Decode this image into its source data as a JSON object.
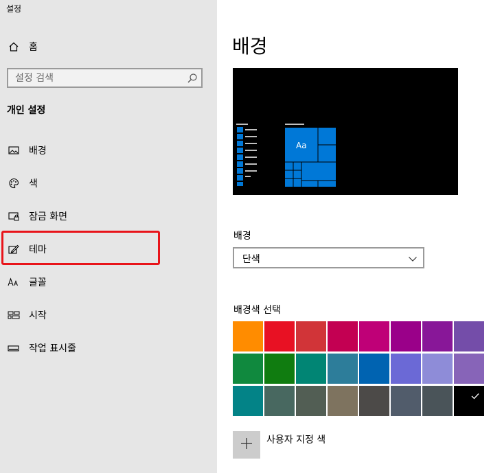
{
  "app": {
    "title": "설정"
  },
  "sidebar": {
    "home_label": "홈",
    "search_placeholder": "설정 검색",
    "section_title": "개인 설정",
    "items": [
      {
        "label": "배경",
        "icon": "picture-icon"
      },
      {
        "label": "색",
        "icon": "palette-icon"
      },
      {
        "label": "잠금 화면",
        "icon": "lock-screen-icon"
      },
      {
        "label": "테마",
        "icon": "theme-brush-icon"
      },
      {
        "label": "글꼴",
        "icon": "font-icon"
      },
      {
        "label": "시작",
        "icon": "start-grid-icon"
      },
      {
        "label": "작업 표시줄",
        "icon": "taskbar-icon"
      }
    ]
  },
  "main": {
    "page_title": "배경",
    "preview_sample_text": "Aa",
    "background_label": "배경",
    "background_value": "단색",
    "color_section_label": "배경색 선택",
    "custom_color_label": "사용자 지정 색",
    "swatches": [
      "#ff8c00",
      "#e81123",
      "#d13438",
      "#c30052",
      "#bf0077",
      "#9a0089",
      "#881798",
      "#744da9",
      "#10893e",
      "#107c10",
      "#018574",
      "#2d7d9a",
      "#0063b1",
      "#6b69d6",
      "#8e8cd8",
      "#8764b8",
      "#038387",
      "#486860",
      "#525e54",
      "#7e735f",
      "#4c4a48",
      "#515c6b",
      "#4a5459",
      "#000000"
    ],
    "selected_swatch_index": 23
  },
  "colors": {
    "sidebar_bg": "#e6e6e6",
    "accent": "#0078d7",
    "highlight": "#e8141a"
  }
}
